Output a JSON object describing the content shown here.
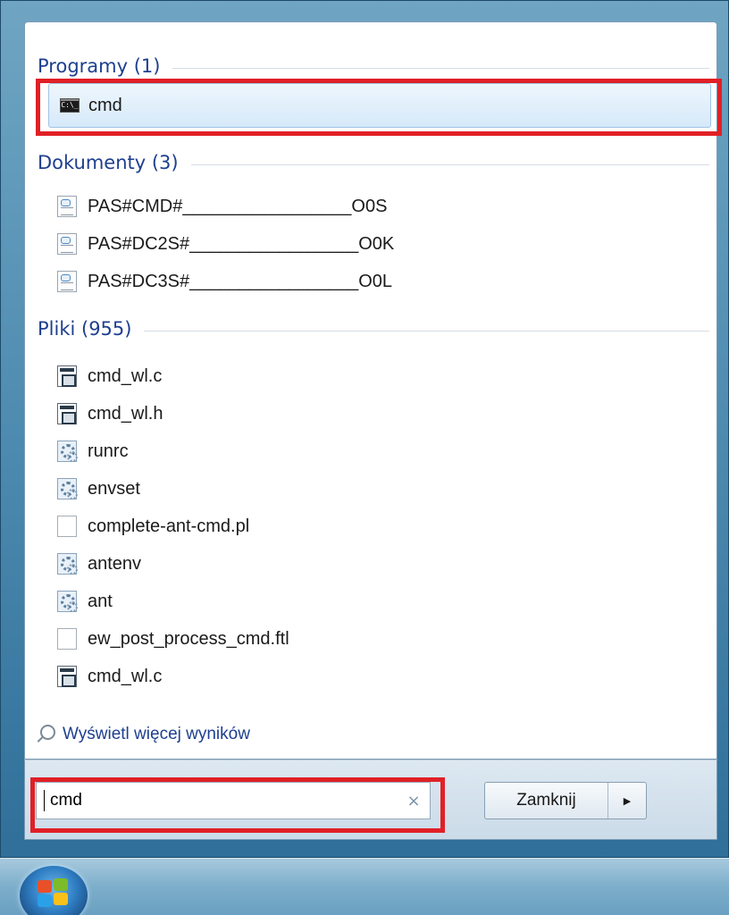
{
  "programs": {
    "heading": "Programy (1)",
    "items": [
      {
        "label": "cmd",
        "icon": "cmd-console-icon"
      }
    ]
  },
  "documents": {
    "heading": "Dokumenty (3)",
    "items": [
      {
        "label": "PAS#CMD#_________________O0S",
        "icon": "document-icon"
      },
      {
        "label": "PAS#DC2S#_________________O0K",
        "icon": "document-icon"
      },
      {
        "label": "PAS#DC3S#_________________O0L",
        "icon": "document-icon"
      }
    ]
  },
  "files": {
    "heading": "Pliki (955)",
    "items": [
      {
        "label": "cmd_wl.c",
        "icon": "c-source-icon"
      },
      {
        "label": "cmd_wl.h",
        "icon": "c-source-icon"
      },
      {
        "label": "runrc",
        "icon": "settings-file-icon"
      },
      {
        "label": "envset",
        "icon": "settings-file-icon"
      },
      {
        "label": "complete-ant-cmd.pl",
        "icon": "blank-file-icon"
      },
      {
        "label": "antenv",
        "icon": "settings-file-icon"
      },
      {
        "label": "ant",
        "icon": "settings-file-icon"
      },
      {
        "label": "ew_post_process_cmd.ftl",
        "icon": "blank-file-icon"
      },
      {
        "label": "cmd_wl.c",
        "icon": "c-source-icon"
      }
    ]
  },
  "more_results": {
    "label": "Wyświetl więcej wyników",
    "icon": "search-icon"
  },
  "search": {
    "value": "cmd",
    "clear_glyph": "×",
    "clear_icon": "clear-icon"
  },
  "shutdown": {
    "label": "Zamknij",
    "arrow_glyph": "▶"
  },
  "taskbar": {
    "start_icon": "windows-start-orb-icon"
  },
  "colors": {
    "highlight": "#e02026",
    "section_heading": "#1e3f8f"
  }
}
